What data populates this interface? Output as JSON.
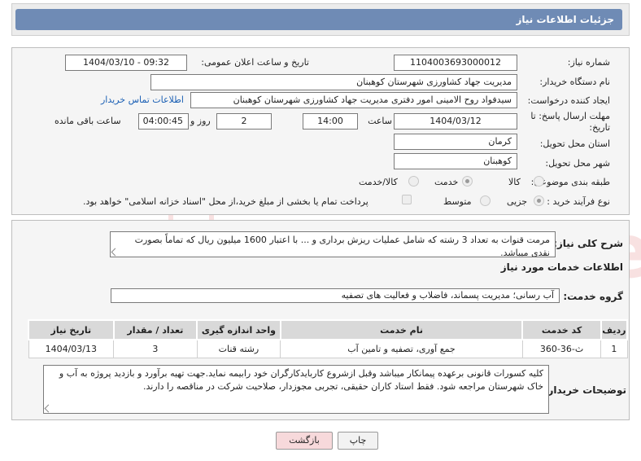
{
  "header": {
    "title": "جزئیات اطلاعات نیاز"
  },
  "form": {
    "need_number_label": "شماره نیاز:",
    "need_number": "1104003693000012",
    "announce_label": "تاریخ و ساعت اعلان عمومی:",
    "announce_value": "1404/03/10 - 09:32",
    "buyer_org_label": "نام دستگاه خریدار:",
    "buyer_org": "مدیریت جهاد کشاورزی شهرستان کوهبنان",
    "creator_label": "ایجاد کننده درخواست:",
    "creator": "سیدفواد روح الامینی امور دفتری مدیریت جهاد کشاورزی شهرستان کوهبنان",
    "contact_link": "اطلاعات تماس خریدار",
    "deadline_label_1": "مهلت ارسال پاسخ: تا",
    "deadline_label_2": "تاریخ:",
    "deadline_date": "1404/03/12",
    "time_label": "ساعت",
    "deadline_time": "14:00",
    "days_value": "2",
    "days_label": "روز و",
    "remaining_time": "04:00:45",
    "remaining_label": "ساعت باقی مانده",
    "province_label": "استان محل تحویل:",
    "province": "کرمان",
    "city_label": "شهر محل تحویل:",
    "city": "کوهبنان",
    "category_label": "طبقه بندی موضوعی:",
    "category_options": [
      "کالا",
      "خدمت",
      "کالا/خدمت"
    ],
    "category_selected": "خدمت",
    "process_label": "نوع فرآیند خرید :",
    "process_options": [
      "جزیی",
      "متوسط"
    ],
    "process_selected": "جزیی",
    "payment_note": "پرداخت تمام یا بخشی از مبلغ خرید،از محل \"اسناد خزانه اسلامی\" خواهد بود."
  },
  "details": {
    "summary_label": "شرح کلی نیاز:",
    "summary": "مرمت قنوات  به تعداد 3 رشته که  شامل عملیات ریزش برداری و ... با اعتبار 1600 میلیون ریال که تماماً بصورت نقدی میباشد.",
    "services_heading": "اطلاعات خدمات مورد نیاز",
    "service_group_label": "گروه خدمت:",
    "service_group": "آب رسانی؛ مدیریت پسماند، فاضلاب و فعالیت های تصفیه",
    "table": {
      "headers": [
        "ردیف",
        "کد خدمت",
        "نام خدمت",
        "واحد اندازه گیری",
        "تعداد / مقدار",
        "تاریخ نیاز"
      ],
      "rows": [
        [
          "1",
          "ث-36-360",
          "جمع آوری، تصفیه و تامین آب",
          "رشته قنات",
          "3",
          "1404/03/13"
        ]
      ]
    },
    "buyer_notes_label": "توضیحات خریدار:",
    "buyer_notes": "کلیه کسورات قانونی برعهده پیمانکار میباشد وقبل ازشروع کاربایدکارگران خود رابیمه نماید.جهت تهیه برآورد و بازدید پروژه به آب و خاک شهرستان مراجعه شود. فقط استاد کاران حقیقی، تجربی مجوزدار، صلاحیت شرکت در مناقصه را دارند."
  },
  "buttons": {
    "print": "چاپ",
    "back": "بازگشت"
  },
  "watermark": {
    "text": "AriaTender.neT"
  },
  "colors": {
    "header": "#6f8bb5",
    "link": "#1a5fb4",
    "back_button": "#f7d9db",
    "watermark": "#d84a4a"
  }
}
